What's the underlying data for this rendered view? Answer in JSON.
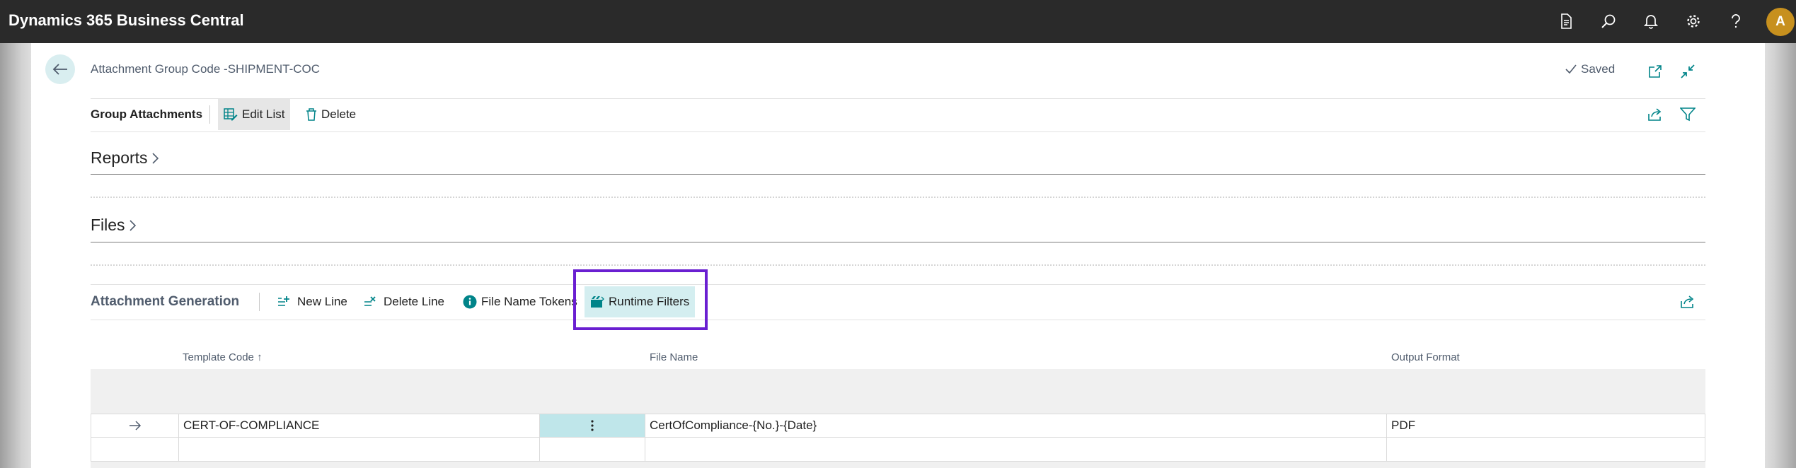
{
  "app": {
    "name": "Dynamics 365 Business Central",
    "user_initial": "A"
  },
  "topbar_icons": [
    "document-icon",
    "search-icon",
    "bell-icon",
    "gear-icon",
    "help-icon"
  ],
  "page": {
    "title": "Attachment Group Code -SHIPMENT-COC",
    "saved_label": "Saved"
  },
  "action_bar": {
    "label": "Group Attachments",
    "edit_list": "Edit List",
    "delete": "Delete"
  },
  "sections": {
    "reports": "Reports",
    "files": "Files"
  },
  "generation": {
    "label": "Attachment Generation",
    "new_line": "New Line",
    "delete_line": "Delete Line",
    "file_name_tokens": "File Name Tokens",
    "runtime_filters": "Runtime Filters"
  },
  "table": {
    "columns": {
      "template_code": "Template Code",
      "sort_indicator": "↑",
      "file_name": "File Name",
      "output_format": "Output Format"
    },
    "rows": [
      {
        "template_code": "CERT-OF-COMPLIANCE",
        "file_name": "CertOfCompliance-{No.}-{Date}",
        "output_format": "PDF"
      },
      {
        "template_code": "",
        "file_name": "",
        "output_format": ""
      }
    ]
  },
  "colors": {
    "accent": "#008489",
    "topbar": "#2a2a2a",
    "highlight_box": "#6a1fd1",
    "avatar": "#c7901e"
  }
}
